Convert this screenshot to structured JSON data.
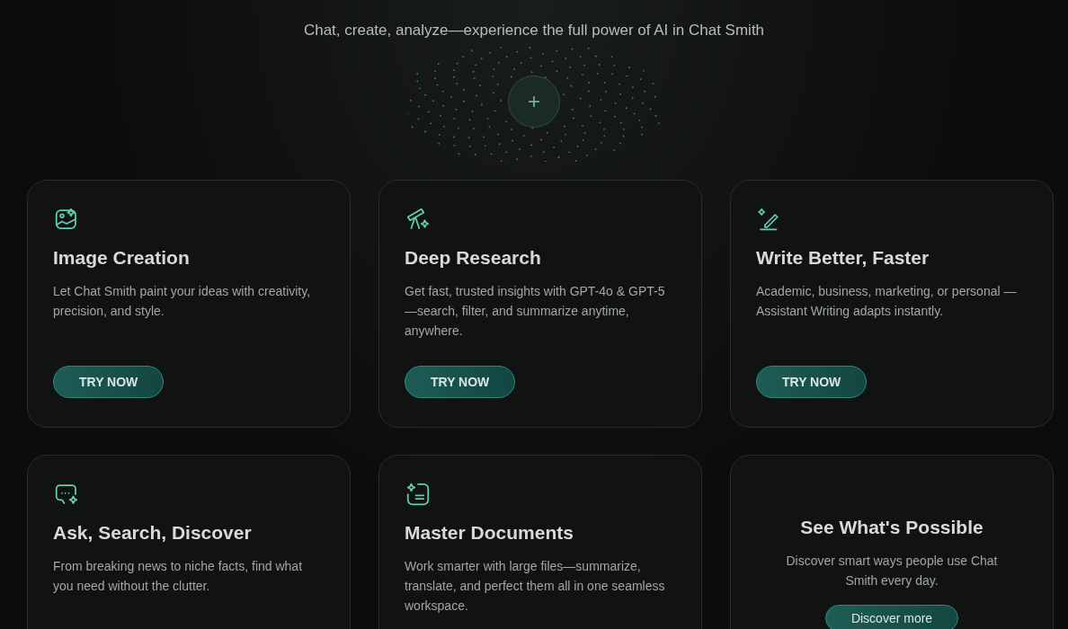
{
  "hero": {
    "subtitle": "Chat, create, analyze—experience the full power of AI in Chat Smith",
    "orb_button": "+"
  },
  "cards": [
    {
      "kind": "feature",
      "title": "Image Creation",
      "text": "Let Chat Smith paint your ideas with creativity, precision, and style.",
      "button": "TRY NOW"
    },
    {
      "kind": "feature",
      "title": "Deep Research",
      "text": "Get fast, trusted insights with GPT-4o & GPT-5—search, filter, and summarize anytime, anywhere.",
      "button": "TRY NOW"
    },
    {
      "kind": "feature",
      "title": "Write Better, Faster",
      "text": "Academic, business, marketing, or personal —Assistant Writing adapts instantly.",
      "button": "TRY NOW"
    },
    {
      "kind": "feature",
      "title": "Ask, Search, Discover",
      "text": "From breaking news to niche facts, find what you need without the clutter."
    },
    {
      "kind": "feature",
      "title": "Master Documents",
      "text": "Work smarter with large files—summarize, translate, and perfect them all in one seamless workspace."
    },
    {
      "kind": "promo",
      "title": "See What's Possible",
      "text": "Discover smart ways people use Chat Smith every day.",
      "button": "Discover more"
    }
  ]
}
